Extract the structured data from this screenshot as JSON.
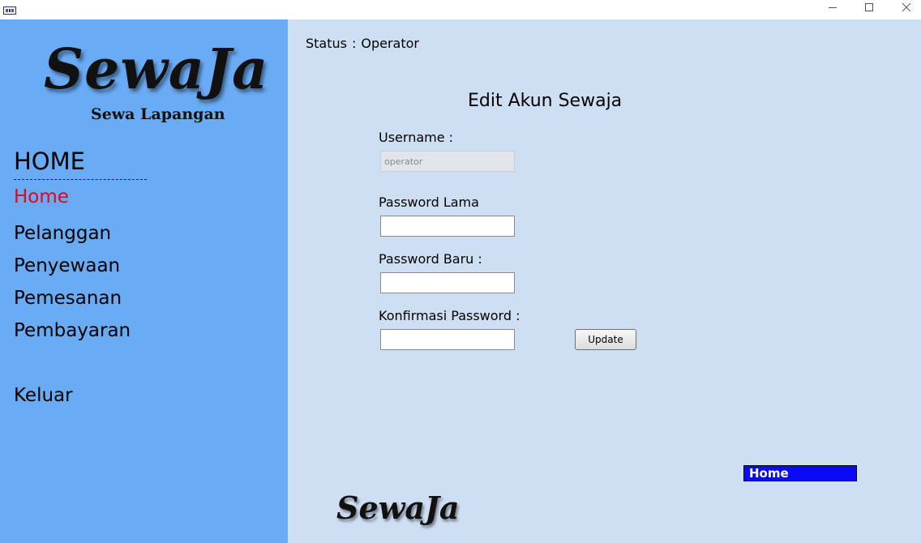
{
  "window": {
    "icons": {
      "app": "app-icon",
      "minimize": "minimize-icon",
      "maximize": "maximize-icon",
      "close": "close-icon"
    }
  },
  "sidebar": {
    "logo_title": "SewaJa",
    "logo_subtitle": "Sewa Lapangan",
    "header": "HOME",
    "items": [
      {
        "label": "Home",
        "active": true
      },
      {
        "label": "Pelanggan",
        "active": false
      },
      {
        "label": "Penyewaan",
        "active": false
      },
      {
        "label": "Pemesanan",
        "active": false
      },
      {
        "label": "Pembayaran",
        "active": false
      },
      {
        "label": "Keluar",
        "active": false
      }
    ],
    "active_color": "#e8001c",
    "background": "#6aabf5"
  },
  "main": {
    "status_label": "Status",
    "status_separator": ":",
    "status_value": "Operator",
    "form_title": "Edit Akun Sewaja",
    "fields": {
      "username_label": "Username :",
      "username_value": "operator",
      "old_password_label": "Password Lama",
      "new_password_label": "Password Baru :",
      "confirm_password_label": "Konfirmasi Password :"
    },
    "update_label": "Update",
    "home_badge": "Home",
    "footer_logo": "SewaJa",
    "background": "#cfdff3",
    "badge_color": "#0a0af5"
  }
}
